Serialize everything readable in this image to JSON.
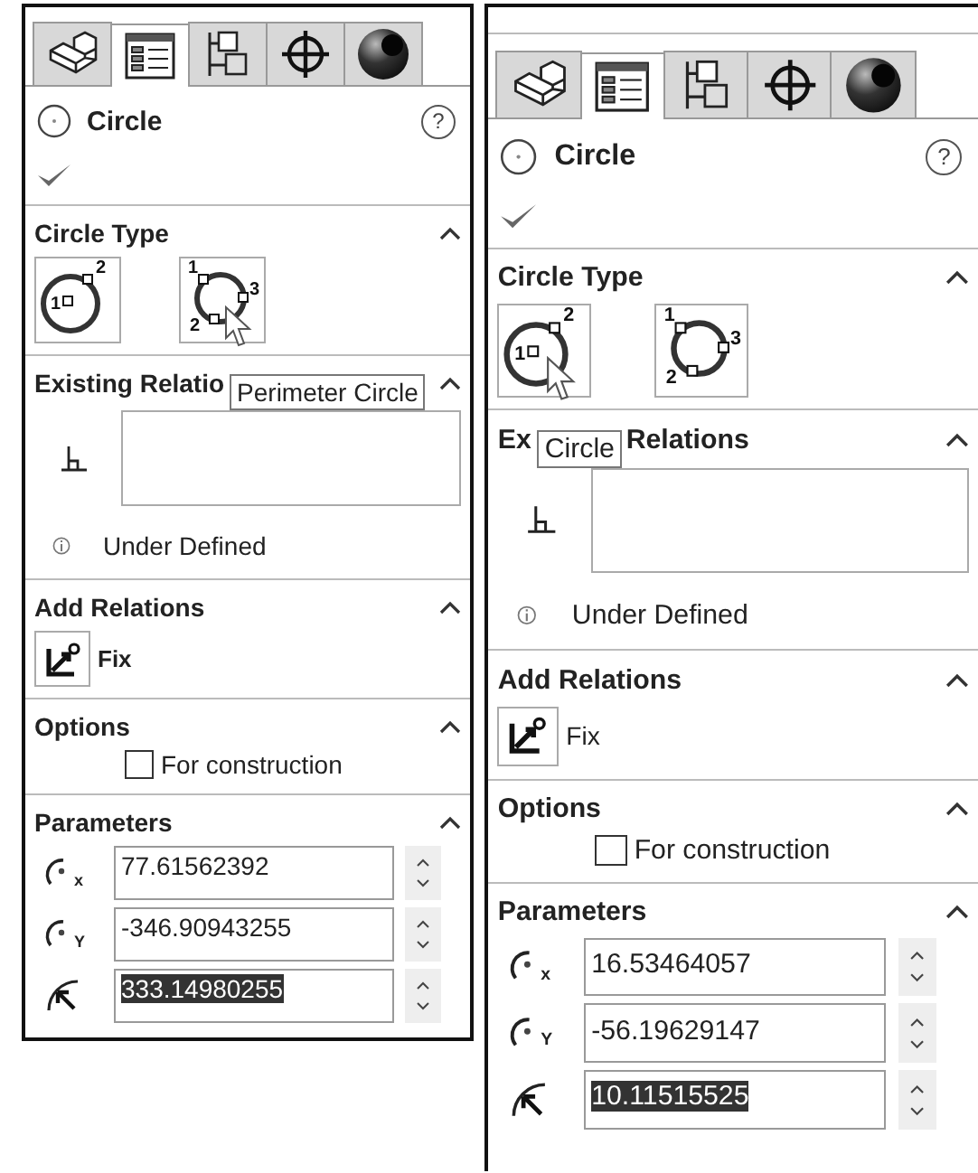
{
  "panels": [
    {
      "tabs": [
        {
          "kind": "part",
          "selected": false
        },
        {
          "kind": "property",
          "selected": true
        },
        {
          "kind": "config",
          "selected": false
        },
        {
          "kind": "target",
          "selected": false
        },
        {
          "kind": "appearance",
          "selected": false
        }
      ],
      "title": "Circle",
      "help": "?",
      "circle_type": {
        "title": "Circle Type",
        "options": [
          {
            "kind": "center",
            "points": [
              "1",
              "2"
            ],
            "hovered": false
          },
          {
            "kind": "perimeter",
            "points": [
              "1",
              "2",
              "3"
            ],
            "hovered": true
          }
        ]
      },
      "existing_relations": {
        "header": [
          {
            "kind": "text",
            "text": "Existing Relatio"
          },
          {
            "kind": "tooltip",
            "text": "Perimeter Circle"
          }
        ],
        "status": "Under Defined"
      },
      "add_relations": {
        "title": "Add Relations",
        "fix": "Fix"
      },
      "options": {
        "title": "Options",
        "construction": {
          "label": "For construction",
          "checked": false
        }
      },
      "parameters": {
        "title": "Parameters",
        "fields": [
          {
            "kind": "point",
            "axis": "x",
            "value": "77.61562392",
            "text_selected": false
          },
          {
            "kind": "point",
            "axis": "Y",
            "value": "-346.90943255",
            "text_selected": false
          },
          {
            "kind": "radius",
            "value": "333.14980255",
            "text_selected": true
          }
        ]
      }
    },
    {
      "tabs": [
        {
          "kind": "part",
          "selected": false
        },
        {
          "kind": "property",
          "selected": true
        },
        {
          "kind": "config",
          "selected": false
        },
        {
          "kind": "target",
          "selected": false
        },
        {
          "kind": "appearance",
          "selected": false
        }
      ],
      "title": "Circle",
      "help": "?",
      "circle_type": {
        "title": "Circle Type",
        "options": [
          {
            "kind": "center",
            "points": [
              "1",
              "2"
            ],
            "hovered": true
          },
          {
            "kind": "perimeter",
            "points": [
              "1",
              "2",
              "3"
            ],
            "hovered": false
          }
        ]
      },
      "existing_relations": {
        "header": [
          {
            "kind": "text",
            "text": "Ex"
          },
          {
            "kind": "tooltip",
            "text": "Circle"
          },
          {
            "kind": "text",
            "text": "Relations"
          }
        ],
        "status": "Under Defined"
      },
      "add_relations": {
        "title": "Add Relations",
        "fix": "Fix"
      },
      "options": {
        "title": "Options",
        "construction": {
          "label": "For construction",
          "checked": false
        }
      },
      "parameters": {
        "title": "Parameters",
        "fields": [
          {
            "kind": "point",
            "axis": "x",
            "value": "16.53464057",
            "text_selected": false
          },
          {
            "kind": "point",
            "axis": "Y",
            "value": "-56.19629147",
            "text_selected": false
          },
          {
            "kind": "radius",
            "value": "10.11515525",
            "text_selected": true
          }
        ]
      }
    }
  ]
}
